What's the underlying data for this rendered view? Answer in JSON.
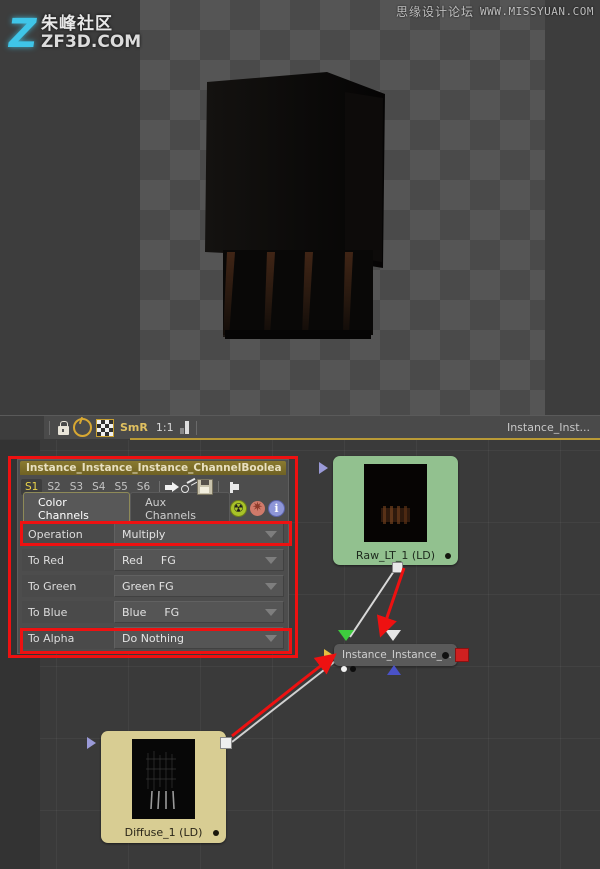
{
  "watermarks": {
    "left_cn": "朱峰社区",
    "left_en": "ZF3D.COM",
    "left_logo_glyph": "Z",
    "top_right_cn": "思缘设计论坛",
    "top_right_en": "WWW.MISSYUAN.COM"
  },
  "viewport": {
    "background": "checkerboard-transparency",
    "checker_colors": [
      "#5a5a5a",
      "#4a4a4a"
    ]
  },
  "viewport_toolbar": {
    "lock_icon": "lock-icon",
    "gamma_icon": "gamma-circle-icon",
    "checker_icon": "alpha-checker-icon",
    "smr_label": "SmR",
    "zoom_ratio": "1:1",
    "bars_icon": "levels-bars-icon",
    "right_title": "Instance_Inst..."
  },
  "properties_panel": {
    "title": "Instance_Instance_Instance_ChannelBoolea",
    "slots": [
      {
        "label": "S1",
        "active": true
      },
      {
        "label": "S2",
        "active": false
      },
      {
        "label": "S3",
        "active": false
      },
      {
        "label": "S4",
        "active": false
      },
      {
        "label": "S5",
        "active": false
      },
      {
        "label": "S6",
        "active": false
      }
    ],
    "slot_icons": [
      "arrow-right-icon",
      "key-icon",
      "save-disk-icon",
      "pin-icon"
    ],
    "tabs": [
      {
        "label": "Color Channels",
        "active": true
      },
      {
        "label": "Aux Channels",
        "active": false
      }
    ],
    "header_icons": [
      "radioactive-icon",
      "gear-icon",
      "info-icon"
    ],
    "rows": [
      {
        "label": "Operation",
        "value": "Multiply",
        "value2": "",
        "highlighted": true
      },
      {
        "label": "To Red",
        "value": "Red",
        "value2": "FG",
        "highlighted": false
      },
      {
        "label": "To Green",
        "value": "Green FG",
        "value2": "",
        "highlighted": false
      },
      {
        "label": "To Blue",
        "value": "Blue",
        "value2": "FG",
        "highlighted": false
      },
      {
        "label": "To Alpha",
        "value": "Do Nothing",
        "value2": "",
        "highlighted": true
      }
    ]
  },
  "node_graph": {
    "nodes": [
      {
        "id": "raw",
        "label": "Raw_LT_1  (LD)",
        "color": "#92c18f"
      },
      {
        "id": "instance",
        "label": "Instance_Instance_...",
        "color": "#5a5a5a"
      },
      {
        "id": "diffuse",
        "label": "Diffuse_1  (LD)",
        "color": "#d8cd93"
      }
    ]
  },
  "annotations": {
    "highlight_color": "#ee1111",
    "boxes": [
      "properties-panel",
      "operation-row",
      "to-alpha-row"
    ],
    "arrow_count": 3
  }
}
